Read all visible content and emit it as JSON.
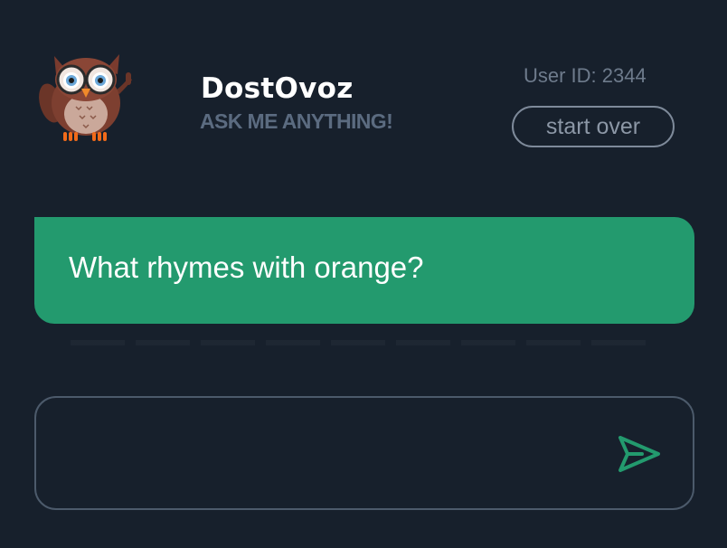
{
  "header": {
    "logo_icon": "owl-mascot-icon",
    "title": "DostOvoz",
    "subtitle": "ASK ME ANYTHING!",
    "user_id_text": "User ID: 2344",
    "start_over_label": "start over"
  },
  "conversation": {
    "messages": [
      {
        "role": "user",
        "text": "What rhymes with orange?"
      }
    ]
  },
  "composer": {
    "input_value": "",
    "input_placeholder": "",
    "send_icon": "send-icon"
  },
  "colors": {
    "background": "#17202c",
    "accent": "#239a6e",
    "muted_text": "#5b6b80",
    "border": "#4c5a6b"
  }
}
